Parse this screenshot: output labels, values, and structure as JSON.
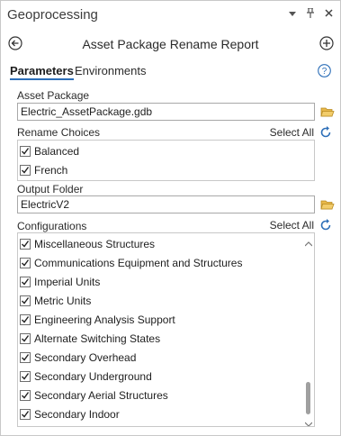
{
  "window": {
    "title": "Geoprocessing",
    "controls": [
      "chevron-down-icon",
      "pin-icon",
      "close-icon"
    ]
  },
  "header": {
    "tool_title": "Asset Package Rename Report",
    "back_icon": "back-arrow-icon",
    "add_icon": "add-circle-icon"
  },
  "tabs": [
    {
      "label": "Parameters",
      "active": true
    },
    {
      "label": "Environments",
      "active": false
    }
  ],
  "help_icon": "help-icon",
  "parameters": {
    "asset_package": {
      "label": "Asset Package",
      "value": "Electric_AssetPackage.gdb"
    },
    "rename_choices": {
      "label": "Rename Choices",
      "select_all": "Select All",
      "items": [
        {
          "label": "Balanced",
          "checked": true
        },
        {
          "label": "French",
          "checked": true
        }
      ]
    },
    "output_folder": {
      "label": "Output Folder",
      "value": "ElectricV2"
    },
    "configurations": {
      "label": "Configurations",
      "select_all": "Select All",
      "items": [
        {
          "label": "Miscellaneous Structures",
          "checked": true
        },
        {
          "label": "Communications Equipment and Structures",
          "checked": true
        },
        {
          "label": "Imperial Units",
          "checked": true
        },
        {
          "label": "Metric Units",
          "checked": true
        },
        {
          "label": "Engineering Analysis Support",
          "checked": true
        },
        {
          "label": "Alternate Switching States",
          "checked": true
        },
        {
          "label": "Secondary Overhead",
          "checked": true
        },
        {
          "label": "Secondary Underground",
          "checked": true
        },
        {
          "label": "Secondary Aerial Structures",
          "checked": true
        },
        {
          "label": "Secondary Indoor",
          "checked": true
        }
      ]
    }
  },
  "colors": {
    "accent": "#2d6fb8",
    "folder": "#e8b84a",
    "border": "#c8c8c8"
  }
}
